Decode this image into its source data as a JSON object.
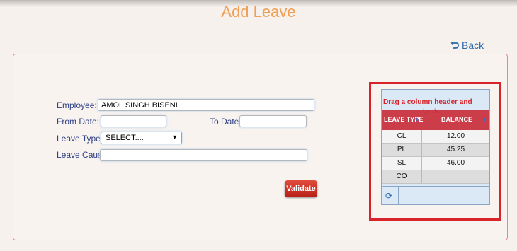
{
  "page": {
    "title": "Add Leave",
    "back_label": "Back"
  },
  "form": {
    "employee_label": "Employee:",
    "employee_value": "AMOL SINGH BISENI",
    "from_date_label": "From Date:",
    "from_date_value": "",
    "to_date_label": "To Date:",
    "to_date_value": "",
    "leave_type_label": "Leave Type:",
    "leave_type_selected": "SELECT....",
    "leave_cause_label": "Leave Cause:",
    "leave_cause_value": "",
    "validate_label": "Validate"
  },
  "grid": {
    "drag_hint": "Drag a column header and drop it",
    "drag_hint_overlap": "by th",
    "headers": {
      "leave_type": "LEAVE TYPE",
      "balance": "BALANCE"
    },
    "rows": [
      {
        "type": "CL",
        "balance": "12.00"
      },
      {
        "type": "PL",
        "balance": "45.25"
      },
      {
        "type": "SL",
        "balance": "46.00"
      },
      {
        "type": "CO",
        "balance": ""
      }
    ]
  },
  "icons": {
    "back": "back-arrow-icon",
    "refresh": "refresh-icon",
    "filter": "filter-icon",
    "dropdown": "chevron-down-icon"
  },
  "colors": {
    "title": "#f0a055",
    "accent_red": "#d8232a",
    "label_blue": "#2d3f84",
    "header_red": "#cc3d4a"
  }
}
